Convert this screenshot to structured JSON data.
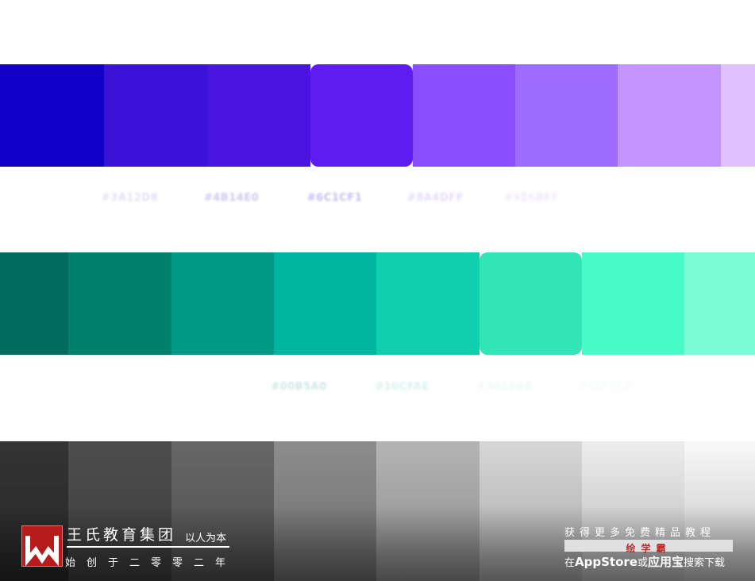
{
  "palettes": [
    {
      "name": "purple",
      "swatches": [
        {
          "color": "#1200c8"
        },
        {
          "color": "#3a12d8"
        },
        {
          "color": "#4a14e0"
        },
        {
          "color": "#5e1cf0",
          "selected": true
        },
        {
          "color": "#8a4dff"
        },
        {
          "color": "#9e6bff"
        },
        {
          "color": "#c495ff"
        },
        {
          "color": "#e0c0ff"
        }
      ],
      "codes": [
        {
          "text": "#3A12D8",
          "color": "#e4e0f6"
        },
        {
          "text": "#4B14E0",
          "color": "#d0c8f2"
        },
        {
          "text": "#6C1CF1",
          "color": "#c6bcf4"
        },
        {
          "text": "#8A4DFF",
          "color": "#e6dcff"
        },
        {
          "text": "#9E6BFF",
          "color": "#f0eaff"
        }
      ]
    },
    {
      "name": "teal",
      "swatches": [
        {
          "color": "#006b5e"
        },
        {
          "color": "#00806f"
        },
        {
          "color": "#009a86"
        },
        {
          "color": "#00b5a0"
        },
        {
          "color": "#10cfae"
        },
        {
          "color": "#33e6b8",
          "selected": true
        },
        {
          "color": "#48fcc5"
        },
        {
          "color": "#7dfdd5"
        }
      ],
      "codes": [
        {
          "text": "#00B5A0",
          "color": "#cfe9e4"
        },
        {
          "text": "#10CFAE",
          "color": "#d6f3ec"
        },
        {
          "text": "#33E6B8",
          "color": "#eefbf6"
        },
        {
          "text": "#48FCC5",
          "color": "#f3fdf9"
        }
      ]
    },
    {
      "name": "gray",
      "swatches": [
        {
          "color": "#333333"
        },
        {
          "color": "#4d4d4d"
        },
        {
          "color": "#666666"
        },
        {
          "color": "#8c8c8c"
        },
        {
          "color": "#b3b3b3"
        },
        {
          "color": "#d6d6d6"
        },
        {
          "color": "#ececec"
        },
        {
          "color": "#f7f7f7"
        }
      ]
    }
  ],
  "brand": {
    "name": "王氏教育集团",
    "slogan": "以人为本",
    "founded": "始创于二零零二年",
    "logo_color": "#b71c1c"
  },
  "promo": {
    "line1": "获得更多免费精品教程",
    "app_name": "绘学霸",
    "line3_prefix": "在",
    "store1": "AppStore",
    "or": "或",
    "store2": "应用宝",
    "line3_suffix": "搜索下载",
    "accent": "#c62828"
  }
}
